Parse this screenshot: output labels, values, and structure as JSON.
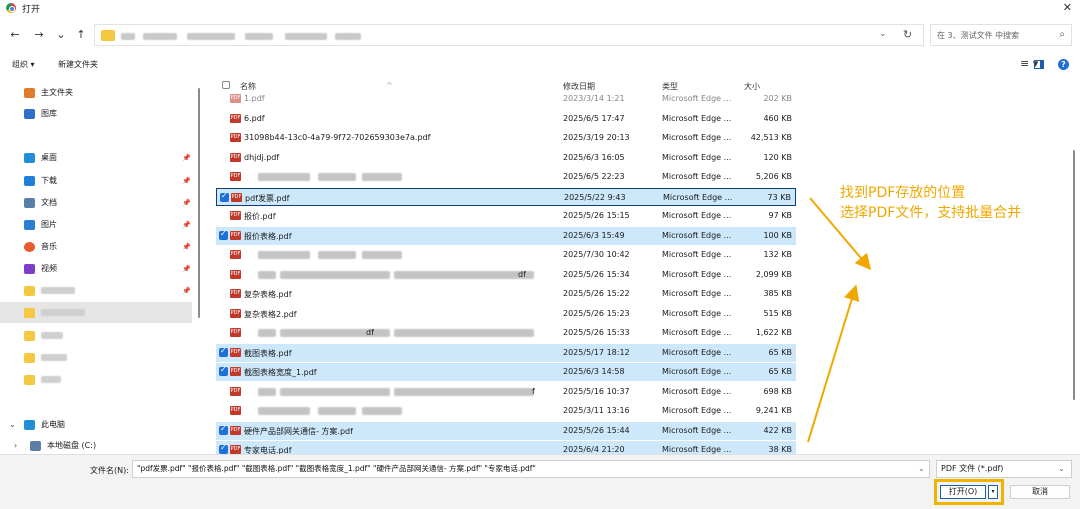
{
  "window": {
    "title": "打开",
    "close": "✕"
  },
  "nav": {
    "back": "←",
    "forward": "→",
    "recent": "⌄",
    "up": "↑",
    "dropdown": "⌄",
    "refresh": "↻"
  },
  "search": {
    "placeholder": "在 3、测试文件 中搜索",
    "icon": "search-icon"
  },
  "toolbar": {
    "organize": "组织 ▾",
    "new_folder": "新建文件夹",
    "view": "≡ ▾",
    "help": "?"
  },
  "sidebar": {
    "items": [
      {
        "label": "主文件夹",
        "icon": "home-icon",
        "color": "#e07b2b"
      },
      {
        "label": "图库",
        "icon": "gallery-icon",
        "color": "#2f6fc9"
      },
      {
        "label": "桌面",
        "icon": "desktop-icon",
        "color": "#1f8fd8",
        "pin": true
      },
      {
        "label": "下载",
        "icon": "download-icon",
        "color": "#1f7fd8",
        "pin": true
      },
      {
        "label": "文档",
        "icon": "document-icon",
        "color": "#5b7ea8",
        "pin": true
      },
      {
        "label": "图片",
        "icon": "picture-icon",
        "color": "#2a7fd4",
        "pin": true
      },
      {
        "label": "音乐",
        "icon": "music-icon",
        "color": "#e85a2c",
        "pin": true
      },
      {
        "label": "视频",
        "icon": "video-icon",
        "color": "#7d3fc9",
        "pin": true
      }
    ],
    "this_pc": "此电脑",
    "local_disk": "本地磁盘 (C:)"
  },
  "columns": {
    "name": "名称",
    "date": "修改日期",
    "type": "类型",
    "size": "大小"
  },
  "files": [
    {
      "name": "1.pdf",
      "date": "2023/3/14 1:21",
      "type": "Microsoft Edge ...",
      "size": "202 KB",
      "state": "partial"
    },
    {
      "name": "6.pdf",
      "date": "2025/6/5 17:47",
      "type": "Microsoft Edge ...",
      "size": "460 KB",
      "state": "normal"
    },
    {
      "name": "31098b44-13c0-4a79-9f72-702659303e7a.pdf",
      "date": "2025/3/19 20:13",
      "type": "Microsoft Edge ...",
      "size": "42,513 KB",
      "state": "normal"
    },
    {
      "name": "dhjdj.pdf",
      "date": "2025/6/3 16:05",
      "type": "Microsoft Edge ...",
      "size": "120 KB",
      "state": "normal"
    },
    {
      "name": "",
      "date": "2025/6/5 22:23",
      "type": "Microsoft Edge ...",
      "size": "5,206 KB",
      "state": "blur"
    },
    {
      "name": "pdf发票.pdf",
      "date": "2025/5/22 9:43",
      "type": "Microsoft Edge ...",
      "size": "73 KB",
      "state": "focused"
    },
    {
      "name": "报价.pdf",
      "date": "2025/5/26 15:15",
      "type": "Microsoft Edge ...",
      "size": "97 KB",
      "state": "normal"
    },
    {
      "name": "报价表格.pdf",
      "date": "2025/6/3 15:49",
      "type": "Microsoft Edge ...",
      "size": "100 KB",
      "state": "selected"
    },
    {
      "name": "",
      "date": "2025/7/30 10:42",
      "type": "Microsoft Edge ...",
      "size": "132 KB",
      "state": "blur"
    },
    {
      "name": "df",
      "date": "2025/5/26 15:34",
      "type": "Microsoft Edge ...",
      "size": "2,099 KB",
      "state": "blur-tail"
    },
    {
      "name": "复杂表格.pdf",
      "date": "2025/5/26 15:22",
      "type": "Microsoft Edge ...",
      "size": "385 KB",
      "state": "normal"
    },
    {
      "name": "复杂表格2.pdf",
      "date": "2025/5/26 15:23",
      "type": "Microsoft Edge ...",
      "size": "515 KB",
      "state": "normal"
    },
    {
      "name": "df",
      "date": "2025/5/26 15:33",
      "type": "Microsoft Edge ...",
      "size": "1,622 KB",
      "state": "blur-tail"
    },
    {
      "name": "截图表格.pdf",
      "date": "2025/5/17 18:12",
      "type": "Microsoft Edge ...",
      "size": "65 KB",
      "state": "selected"
    },
    {
      "name": "截图表格宽度_1.pdf",
      "date": "2025/6/3 14:58",
      "type": "Microsoft Edge ...",
      "size": "65 KB",
      "state": "selected"
    },
    {
      "name": "f",
      "date": "2025/5/16 10:37",
      "type": "Microsoft Edge ...",
      "size": "698 KB",
      "state": "blur-tail"
    },
    {
      "name": "",
      "date": "2025/3/11 13:16",
      "type": "Microsoft Edge ...",
      "size": "9,241 KB",
      "state": "blur"
    },
    {
      "name": "硬件产品部网关通信- 方案.pdf",
      "date": "2025/5/26 15:44",
      "type": "Microsoft Edge ...",
      "size": "422 KB",
      "state": "selected"
    },
    {
      "name": "专家电话.pdf",
      "date": "2025/6/4 21:20",
      "type": "Microsoft Edge ...",
      "size": "38 KB",
      "state": "selected"
    }
  ],
  "annotation": {
    "line1": "找到PDF存放的位置",
    "line2": "选择PDF文件，支持批量合并",
    "color": "#f0a800"
  },
  "bottom": {
    "filename_label": "文件名(N):",
    "filename_value": "\"pdf发票.pdf\" \"报价表格.pdf\" \"截图表格.pdf\" \"截图表格宽度_1.pdf\" \"硬件产品部网关通信- 方案.pdf\" \"专家电话.pdf\"",
    "filetype": "PDF 文件 (*.pdf)",
    "open": "打开(O)",
    "open_split": "▾",
    "cancel": "取消"
  }
}
